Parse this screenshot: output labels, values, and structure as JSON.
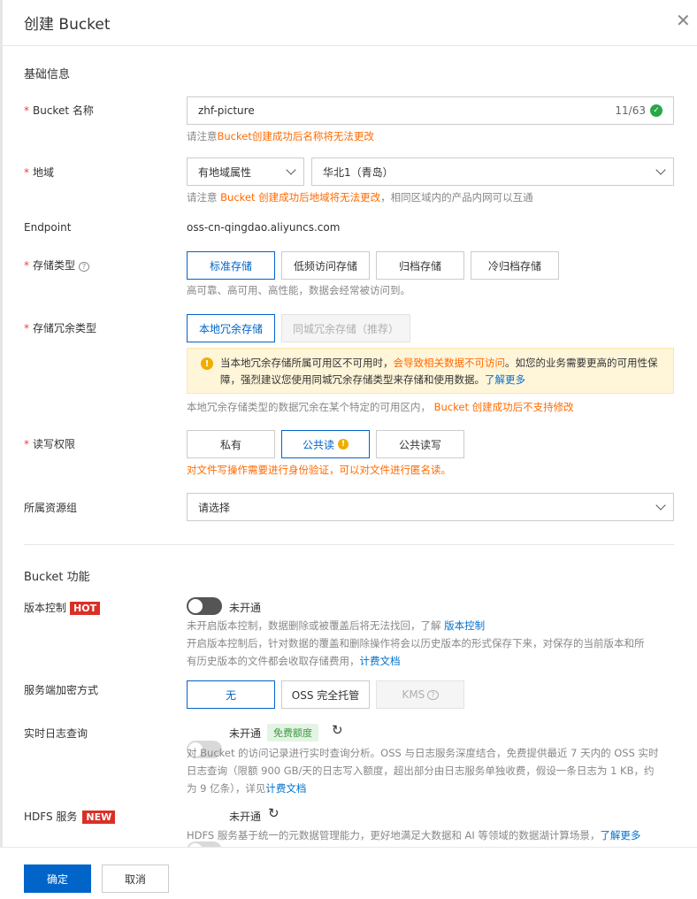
{
  "title": "创建 Bucket",
  "basic": {
    "section_title": "基础信息",
    "bucket_name": {
      "label": "Bucket 名称",
      "value": "zhf-picture",
      "count": "11/63",
      "help_prefix": "请注意",
      "help_warn": "Bucket创建成功后名称将无法更改"
    },
    "region": {
      "label": "地域",
      "type_value": "有地域属性",
      "region_value": "华北1（青岛）",
      "help_prefix": "请注意 ",
      "help_warn": "Bucket 创建成功后地域将无法更改",
      "help_suffix": "，相同区域内的产品内网可以互通"
    },
    "endpoint": {
      "label": "Endpoint",
      "value": "oss-cn-qingdao.aliyuncs.com"
    },
    "storage_type": {
      "label": "存储类型",
      "options": [
        "标准存储",
        "低频访问存储",
        "归档存储",
        "冷归档存储"
      ],
      "selected": "标准存储",
      "help": "高可靠、高可用、高性能，数据会经常被访问到。"
    },
    "redundancy": {
      "label": "存储冗余类型",
      "options": [
        "本地冗余存储",
        "同城冗余存储（推荐）"
      ],
      "selected": "本地冗余存储",
      "notice_prefix": "当本地冗余存储所属可用区不可用时，",
      "notice_warn": "会导致相关数据不可访问",
      "notice_suffix": "。如您的业务需要更高的可用性保障，强烈建议您使用同城冗余存储类型来存储和使用数据。",
      "notice_link": "了解更多",
      "help_prefix": "本地冗余存储类型的数据冗余在某个特定的可用区内，",
      "help_warn": "Bucket 创建成功后不支持修改"
    },
    "acl": {
      "label": "读写权限",
      "options": [
        "私有",
        "公共读",
        "公共读写"
      ],
      "selected": "公共读",
      "help_warn": "对文件写操作需要进行身份验证，可以对文件进行匿名读。"
    },
    "resource_group": {
      "label": "所属资源组",
      "placeholder": "请选择"
    }
  },
  "features": {
    "section_title": "Bucket 功能",
    "versioning": {
      "label": "版本控制",
      "badge": "HOT",
      "status": "未开通",
      "help1_prefix": "未开启版本控制，数据删除或被覆盖后将无法找回，了解 ",
      "help1_link": "版本控制",
      "help2_line1": "开启版本控制后，针对数据的覆盖和删除操作将会以历史版本的形式保存下来，对保存的当前版本和所",
      "help2_line2_prefix": "有历史版本的文件都会收取存储费用，",
      "help2_link": "计费文档"
    },
    "encryption": {
      "label": "服务端加密方式",
      "options": [
        "无",
        "OSS 完全托管",
        "KMS"
      ],
      "selected": "无"
    },
    "realtime_log": {
      "label": "实时日志查询",
      "status": "未开通",
      "tag": "免费额度",
      "help_line1": "对 Bucket 的访问记录进行实时查询分析。OSS 与日志服务深度结合，免费提供最近 7 天内的 OSS 实时",
      "help_line2": "日志查询（限额 900 GB/天的日志写入额度，超出部分由日志服务单独收费，假设一条日志为 1 KB，约",
      "help_line3_prefix": "为 9 亿条），详见",
      "help_link": "计费文档"
    },
    "hdfs": {
      "label": "HDFS 服务",
      "badge": "NEW",
      "status": "未开通",
      "help_prefix": "HDFS 服务基于统一的元数据管理能力，更好地满足大数据和 AI 等领域的数据湖计算场景，",
      "help_link": "了解更多"
    }
  },
  "footer": {
    "confirm": "确定",
    "cancel": "取消"
  }
}
